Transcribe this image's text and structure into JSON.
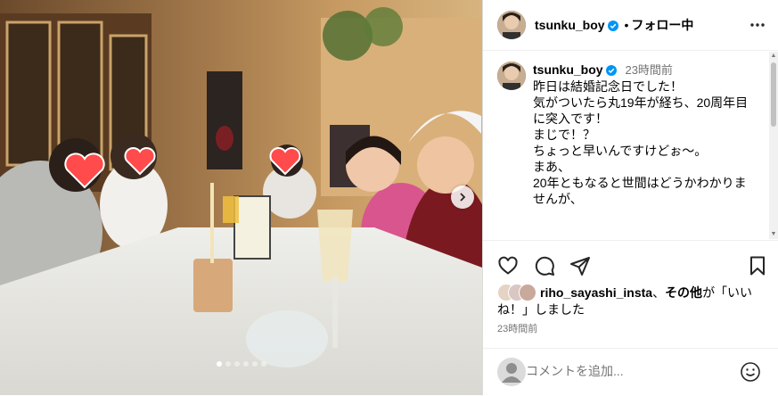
{
  "post": {
    "username": "tsunku_boy",
    "separator": "•",
    "follow_status": "フォロー中",
    "caption_username": "tsunku_boy",
    "caption_time": "23時間前",
    "caption_lines": [
      "昨日は結婚記念日でした！",
      "気がついたら丸19年が経ち、20周年目",
      "に突入です！",
      "",
      "まじで！？",
      "ちょっと早いんですけどぉ〜。",
      "",
      "まあ、",
      "20年ともなると世間はどうかわかりま",
      "せんが、"
    ],
    "liked_by_user": "riho_sayashi_insta",
    "liked_by_sep": "、",
    "liked_by_others": "その他",
    "liked_by_suffix": "が「いいね！」しました",
    "time": "23時間前",
    "comment_placeholder": "コメントを追加...",
    "carousel": {
      "count": 6,
      "active_index": 0
    }
  },
  "colors": {
    "verified": "#0095f6",
    "muted": "#737373"
  }
}
